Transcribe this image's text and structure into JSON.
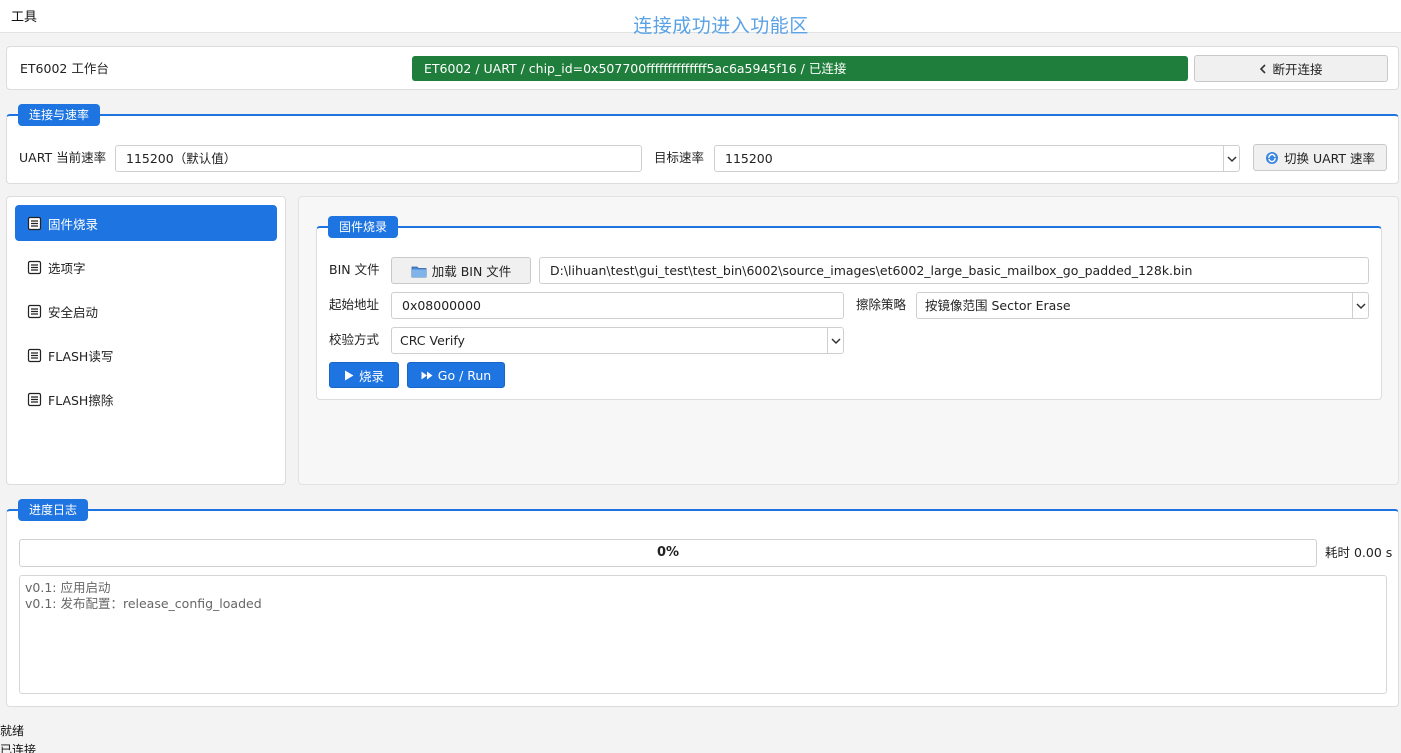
{
  "menu": {
    "tools": "工具"
  },
  "banner": "连接成功进入功能区",
  "header": {
    "workbench": "ET6002 工作台",
    "connection_status": "ET6002 / UART / chip_id=0x507700ffffffffffffff5ac6a5945f16 / 已连接",
    "disconnect_label": "断开连接"
  },
  "speed_group": {
    "title": "连接与速率",
    "current_label": "UART 当前速率",
    "current_value": "115200（默认值）",
    "target_label": "目标速率",
    "target_value": "115200",
    "switch_label": "切换 UART 速率"
  },
  "sidebar": {
    "items": [
      {
        "label": "固件烧录",
        "active": true
      },
      {
        "label": "选项字",
        "active": false
      },
      {
        "label": "安全启动",
        "active": false
      },
      {
        "label": "FLASH读写",
        "active": false
      },
      {
        "label": "FLASH擦除",
        "active": false
      }
    ]
  },
  "firmware": {
    "title": "固件烧录",
    "bin_label": "BIN 文件",
    "load_bin_label": "加载 BIN 文件",
    "bin_path": "D:\\lihuan\\test\\gui_test\\test_bin\\6002\\source_images\\et6002_large_basic_mailbox_go_padded_128k.bin",
    "start_addr_label": "起始地址",
    "start_addr_value": "0x08000000",
    "erase_label": "擦除策略",
    "erase_value": "按镜像范围 Sector Erase",
    "verify_label": "校验方式",
    "verify_value": "CRC Verify",
    "burn_label": "烧录",
    "go_label": "Go / Run"
  },
  "progress_group": {
    "title": "进度日志",
    "progress_text": "0%",
    "progress_value": 0,
    "elapsed": "耗时 0.00 s",
    "log_lines": [
      "v0.1: 应用启动",
      "v0.1: 发布配置：release_config_loaded"
    ]
  },
  "statusbar": {
    "line1": "就绪",
    "line2": "已连接"
  },
  "colors": {
    "accent": "#1e74e0",
    "connected": "#1f7e3b",
    "banner": "#5aa2e6"
  }
}
